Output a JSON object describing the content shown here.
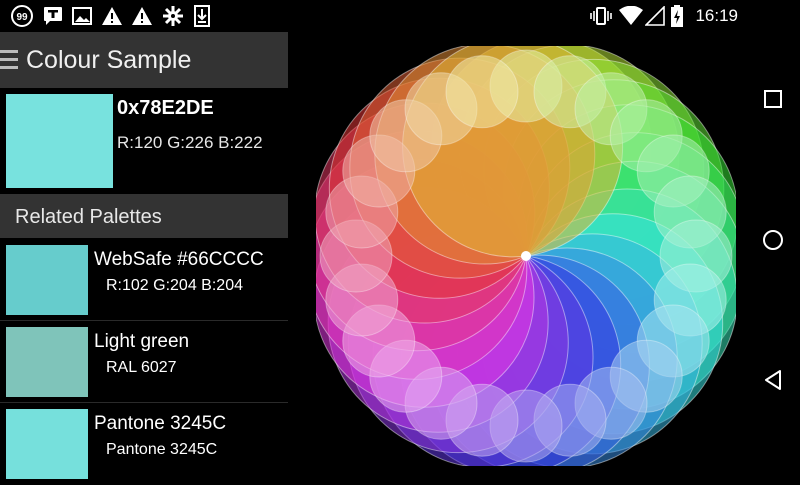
{
  "status_bar": {
    "time": "16:19",
    "notification_badge": "99",
    "left_icons": [
      "badge-99-icon",
      "message-icon",
      "image-icon",
      "warning-icon",
      "warning-icon",
      "puzzle-icon",
      "download-icon"
    ],
    "right_icons": [
      "vibrate-icon",
      "wifi-icon",
      "signal-icon",
      "battery-charging-icon"
    ]
  },
  "app": {
    "title": "Colour Sample",
    "sample": {
      "color": "#78E2DE",
      "hex_label": "0x78E2DE",
      "rgb_label": "R:120 G:226 B:222"
    },
    "related_title": "Related Palettes",
    "related": [
      {
        "color": "#66CCCC",
        "name": "WebSafe #66CCCC",
        "detail": "R:102 G:204 B:204"
      },
      {
        "color": "#7FC4BA",
        "name": "Light green",
        "detail": "RAL 6027"
      },
      {
        "color": "#76E0DC",
        "name": "Pantone 3245C",
        "detail": "Pantone 3245C"
      }
    ]
  },
  "navigation": {
    "buttons": [
      "recents-icon",
      "home-icon",
      "back-icon"
    ]
  }
}
